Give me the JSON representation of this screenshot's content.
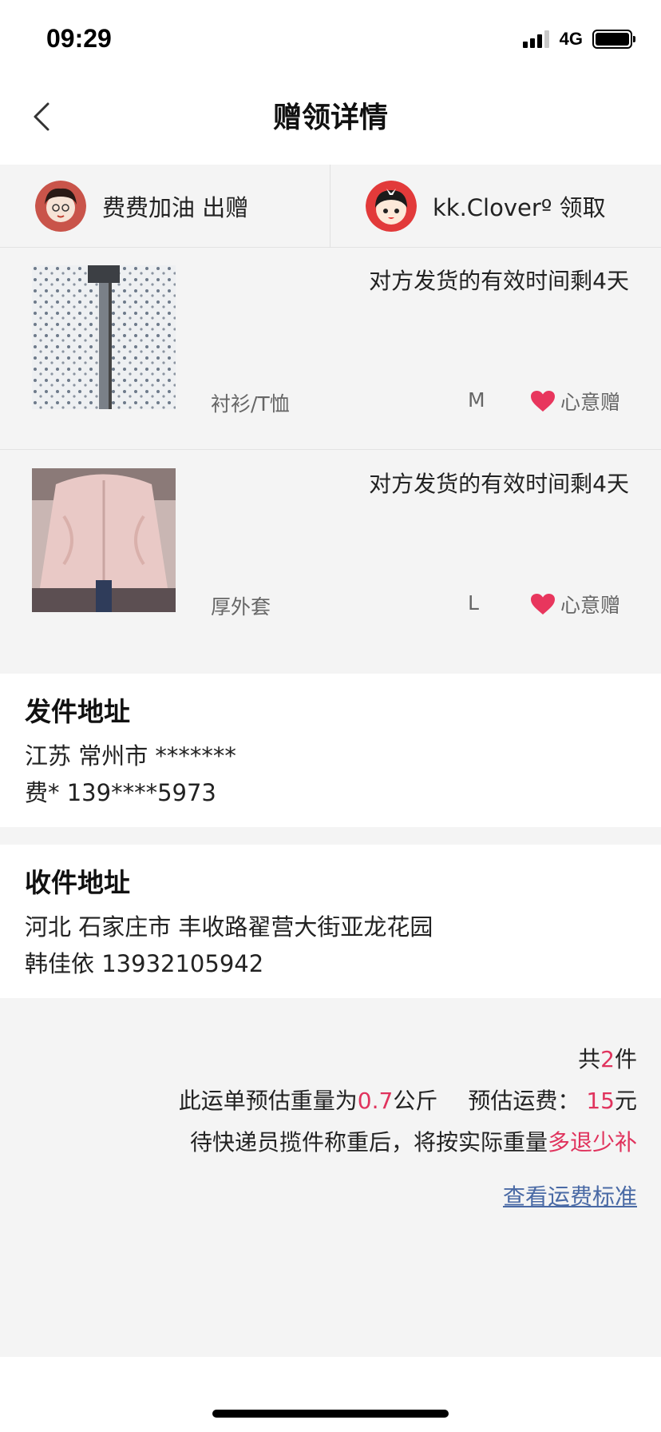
{
  "status_bar": {
    "time": "09:29",
    "network": "4G"
  },
  "nav": {
    "title": "赠领详情",
    "back_icon": "chevron-left-icon"
  },
  "parties": {
    "giver": {
      "name": "费费加油 出赠"
    },
    "receiver": {
      "name": "kk.Cloverº 领取"
    }
  },
  "items": [
    {
      "time_left": "对方发货的有效时间剩4天",
      "category": "衬衫/T恤",
      "size": "M",
      "tag": "心意赠"
    },
    {
      "time_left": "对方发货的有效时间剩4天",
      "category": "厚外套",
      "size": "L",
      "tag": "心意赠"
    }
  ],
  "sender": {
    "title": "发件地址",
    "region": "江苏 常州市 *******",
    "contact": "费* 139****5973"
  },
  "receiver": {
    "title": "收件地址",
    "address": "河北 石家庄市 丰收路翟营大街亚龙花园",
    "contact": "韩佳依 13932105942"
  },
  "summary": {
    "count_prefix": "共",
    "count": "2",
    "count_suffix": "件",
    "weight_prefix": "此运单预估重量为",
    "weight": "0.7",
    "weight_unit": "公斤",
    "fee_prefix": "预估运费：",
    "fee": "15",
    "fee_unit": "元",
    "note_prefix": "待快递员揽件称重后，将按实际重量",
    "note_highlight": "多退少补",
    "fee_link": "查看运费标准"
  },
  "colors": {
    "highlight": "#e0335d",
    "link": "#4a6aa5",
    "heart": "#e8365d"
  }
}
